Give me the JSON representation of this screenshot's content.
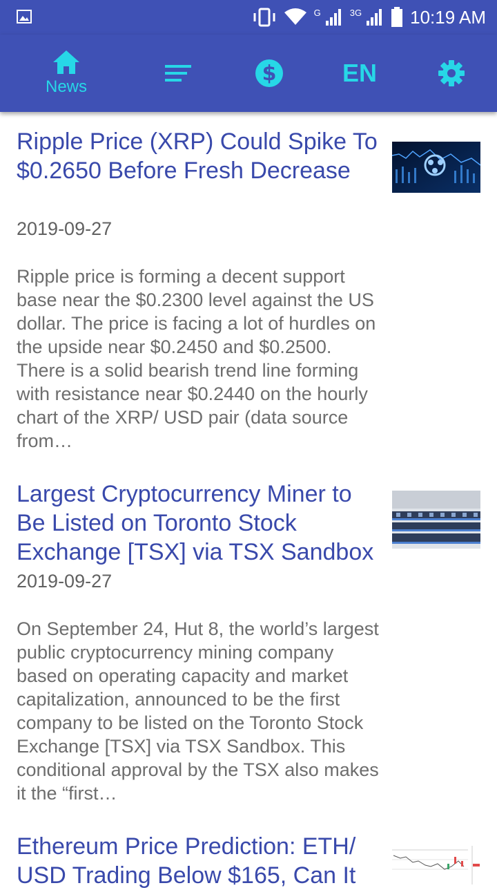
{
  "status_bar": {
    "network_label_1": "G",
    "network_label_2": "3G",
    "time": "10:19 AM",
    "icons": [
      "image-icon",
      "vibrate-icon",
      "wifi-icon",
      "signal-icon",
      "signal-icon",
      "battery-icon"
    ]
  },
  "nav": {
    "news_label": "News",
    "language": "EN",
    "accent_color": "#27d7e7",
    "bar_color": "#3f51b5",
    "icons": [
      "home-icon",
      "menu-icon",
      "dollar-icon",
      "gear-icon"
    ]
  },
  "articles": [
    {
      "title": "Ripple Price (XRP) Could Spike To $0.2650 Before Fresh Decrease",
      "date": "2019-09-27",
      "summary": "Ripple price is forming a decent support base near the $0.2300 level against the US dollar. The price is facing a lot of hurdles on the upside near $0.2450 and $0.2500. There is a solid bearish trend line forming with resistance near $0.2440 on the hourly chart of the XRP/ USD pair (data source from…"
    },
    {
      "title": "Largest Cryptocurrency Miner to Be Listed on Toronto Stock Exchange [TSX] via TSX Sandbox",
      "date": "2019-09-27",
      "summary": "On September 24, Hut 8, the world’s largest public cryptocurrency mining company based on operating capacity and market capitalization, announced to be the first company to be listed on the Toronto Stock Exchange [TSX] via TSX Sandbox. This conditional approval by the TSX also makes it the “first…"
    },
    {
      "title": "Ethereum Price Prediction: ETH/ USD Trading Below $165, Can It"
    }
  ]
}
